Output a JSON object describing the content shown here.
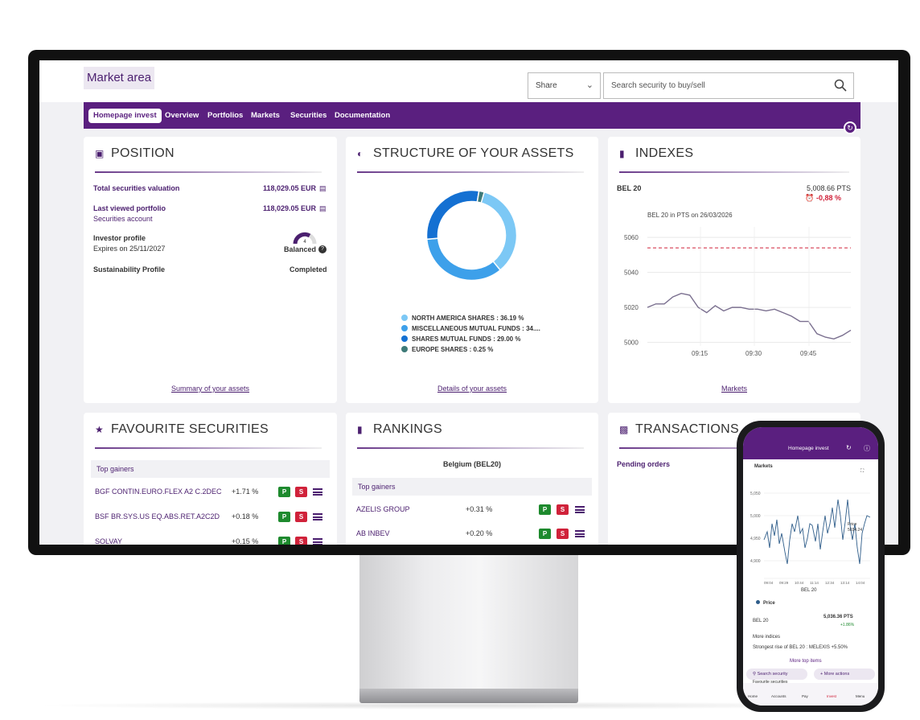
{
  "header": {
    "market_area": "Market area",
    "share_label": "Share",
    "search_placeholder": "Search security to buy/sell"
  },
  "nav": {
    "items": [
      "Homepage invest",
      "Overview",
      "Portfolios",
      "Markets",
      "Securities",
      "Documentation"
    ]
  },
  "position": {
    "title": "POSITION",
    "total_label": "Total securities valuation",
    "total_value": "118,029.05 EUR",
    "last_viewed_label": "Last viewed portfolio",
    "last_viewed_value": "118,029.05 EUR",
    "account_label": "Securities account",
    "investor_label": "Investor profile",
    "expires_label": "Expires on 25/11/2027",
    "profile_level": "4",
    "profile_value": "Balanced",
    "sustain_label": "Sustainability Profile",
    "sustain_value": "Completed",
    "link": "Summary of your assets"
  },
  "structure": {
    "title": "STRUCTURE OF YOUR ASSETS",
    "legend": [
      {
        "label": "NORTH AMERICA SHARES : 36.19 %",
        "color": "#7cc8f5"
      },
      {
        "label": "MISCELLANEOUS MUTUAL FUNDS : 34....",
        "color": "#3da0ea"
      },
      {
        "label": "SHARES MUTUAL FUNDS : 29.00 %",
        "color": "#1470d2"
      },
      {
        "label": "EUROPE SHARES : 0.25 %",
        "color": "#3e7a78"
      }
    ],
    "link": "Details of your assets"
  },
  "indexes": {
    "title": "INDEXES",
    "index_name": "BEL 20",
    "index_value": "5,008.66 PTS",
    "index_change": "-0,88 %",
    "chart_caption": "BEL 20 in PTS on 26/03/2026",
    "link": "Markets"
  },
  "chart_data": {
    "type": "line",
    "title": "BEL 20 in PTS on 26/03/2026",
    "xlabel": "",
    "ylabel": "",
    "x_ticks": [
      "09:15",
      "09:30",
      "09:45"
    ],
    "y_ticks": [
      5000,
      5020,
      5040,
      5060
    ],
    "ylim": [
      4998,
      5066
    ],
    "reference_line": 5054,
    "series": [
      {
        "values": [
          5020,
          5022,
          5022,
          5026,
          5028,
          5027,
          5020,
          5017,
          5021,
          5018,
          5020,
          5020,
          5019,
          5019,
          5018,
          5019,
          5017,
          5015,
          5012,
          5012,
          5005,
          5003,
          5002,
          5004,
          5007
        ]
      }
    ]
  },
  "favourites": {
    "title": "FAVOURITE SECURITIES",
    "band": "Top gainers",
    "rows": [
      {
        "name": "BGF CONTIN.EURO.FLEX A2 C.2DEC",
        "pct": "+1.71 %"
      },
      {
        "name": "BSF BR.SYS.US EQ.ABS.RET.A2C2D",
        "pct": "+0.18 %"
      },
      {
        "name": "SOLVAY",
        "pct": "+0.15 %"
      }
    ],
    "p": "P",
    "s": "S"
  },
  "rankings": {
    "title": "RANKINGS",
    "subtitle": "Belgium (BEL20)",
    "band": "Top gainers",
    "rows": [
      {
        "name": "AZELIS GROUP",
        "pct": "+0.31 %"
      },
      {
        "name": "AB INBEV",
        "pct": "+0.20 %"
      }
    ]
  },
  "transactions": {
    "title": "TRANSACTIONS",
    "pending": "Pending orders"
  },
  "phone": {
    "title": "Homepage invest",
    "markets": "Markets",
    "price": "Price",
    "price_value": "5034.24",
    "axis_label": "BEL 20",
    "y_ticks": [
      "5,050",
      "5,000",
      "4,950",
      "4,900"
    ],
    "x_ticks": [
      "09:04",
      "09:29",
      "10:44",
      "11:14",
      "12:34",
      "13:14",
      "14:04"
    ],
    "legend": "Price",
    "bel20": "BEL 20",
    "bel20_value": "5,036.36 PTS",
    "bel20_change": "+1.86%",
    "more_indices": "More indices",
    "strongest": "Strongest rise of BEL 20 : MELEXIS +5.50%",
    "more_top": "More top items",
    "search": "Search security",
    "more_actions": "More actions",
    "fav": "Favourite securities",
    "tabs": [
      "Home",
      "Accounts",
      "Pay",
      "Invest",
      "Menu"
    ]
  }
}
